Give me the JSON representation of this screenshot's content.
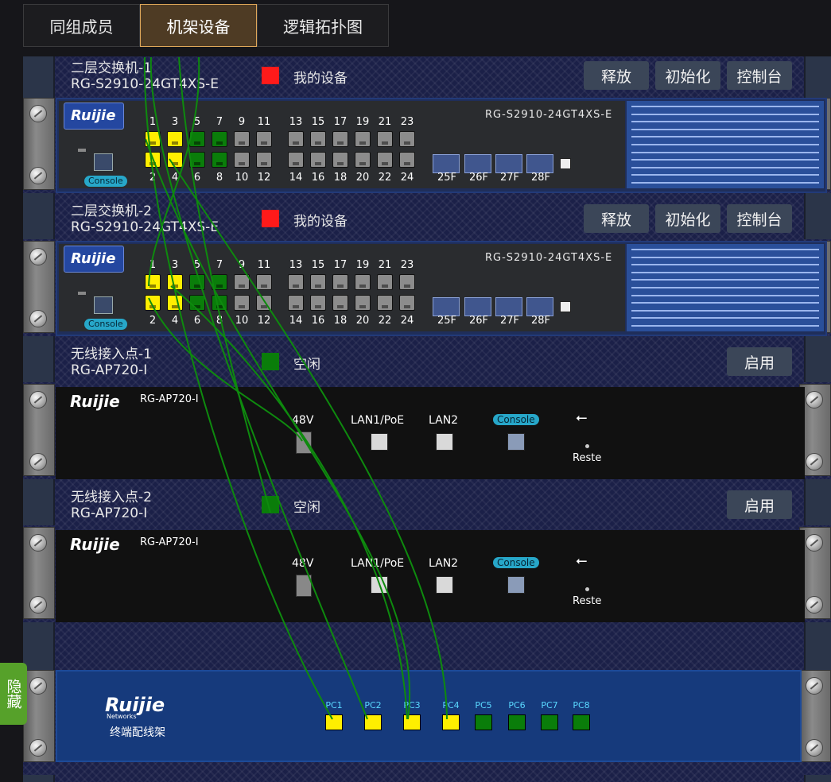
{
  "tabs": [
    {
      "label": "同组成员",
      "active": false
    },
    {
      "label": "机架设备",
      "active": true
    },
    {
      "label": "逻辑拓扑图",
      "active": false
    }
  ],
  "devices": [
    {
      "name": "二层交换机-1",
      "model": "RG-S2910-24GT4XS-E",
      "status_color": "#ff1a1a",
      "status": "我的设备",
      "buttons": [
        "释放",
        "初始化",
        "控制台"
      ],
      "brand": "Ruijie",
      "panel_model": "RG-S2910-24GT4XS-E",
      "top_port_labels": [
        "1",
        "3",
        "5",
        "7",
        "9",
        "11",
        "13",
        "15",
        "17",
        "19",
        "21",
        "23"
      ],
      "bottom_port_labels": [
        "2",
        "4",
        "6",
        "8",
        "10",
        "12",
        "14",
        "16",
        "18",
        "20",
        "22",
        "24"
      ],
      "sfp_labels": [
        "25F",
        "26F",
        "27F",
        "28F"
      ],
      "console_label": "Console",
      "port_colors_top": [
        "#ffee00",
        "#ffee00",
        "#0a7d0a",
        "#0a7d0a",
        "#8c8c8c",
        "#8c8c8c",
        "#8c8c8c",
        "#8c8c8c",
        "#8c8c8c",
        "#8c8c8c",
        "#8c8c8c",
        "#8c8c8c"
      ],
      "port_colors_bottom": [
        "#ffee00",
        "#ffee00",
        "#0a7d0a",
        "#0a7d0a",
        "#8c8c8c",
        "#8c8c8c",
        "#8c8c8c",
        "#8c8c8c",
        "#8c8c8c",
        "#8c8c8c",
        "#8c8c8c",
        "#8c8c8c"
      ]
    },
    {
      "name": "二层交换机-2",
      "model": "RG-S2910-24GT4XS-E",
      "status_color": "#ff1a1a",
      "status": "我的设备",
      "buttons": [
        "释放",
        "初始化",
        "控制台"
      ],
      "brand": "Ruijie",
      "panel_model": "RG-S2910-24GT4XS-E",
      "top_port_labels": [
        "1",
        "3",
        "5",
        "7",
        "9",
        "11",
        "13",
        "15",
        "17",
        "19",
        "21",
        "23"
      ],
      "bottom_port_labels": [
        "2",
        "4",
        "6",
        "8",
        "10",
        "12",
        "14",
        "16",
        "18",
        "20",
        "22",
        "24"
      ],
      "sfp_labels": [
        "25F",
        "26F",
        "27F",
        "28F"
      ],
      "console_label": "Console",
      "port_colors_top": [
        "#ffee00",
        "#ffee00",
        "#0a7d0a",
        "#0a7d0a",
        "#8c8c8c",
        "#8c8c8c",
        "#8c8c8c",
        "#8c8c8c",
        "#8c8c8c",
        "#8c8c8c",
        "#8c8c8c",
        "#8c8c8c"
      ],
      "port_colors_bottom": [
        "#ffee00",
        "#ffee00",
        "#0a7d0a",
        "#0a7d0a",
        "#8c8c8c",
        "#8c8c8c",
        "#8c8c8c",
        "#8c8c8c",
        "#8c8c8c",
        "#8c8c8c",
        "#8c8c8c",
        "#8c8c8c"
      ]
    },
    {
      "name": "无线接入点-1",
      "model": "RG-AP720-I",
      "status_color": "#0a7d0a",
      "status": "空闲",
      "buttons": [
        "启用"
      ],
      "brand": "Ruijie",
      "panel_model": "RG-AP720-I",
      "ap_labels": {
        "power": "48V",
        "lan1": "LAN1/PoE",
        "lan2": "LAN2",
        "console": "Console",
        "reset": "Reste"
      }
    },
    {
      "name": "无线接入点-2",
      "model": "RG-AP720-I",
      "status_color": "#0a7d0a",
      "status": "空闲",
      "buttons": [
        "启用"
      ],
      "brand": "Ruijie",
      "panel_model": "RG-AP720-I",
      "ap_labels": {
        "power": "48V",
        "lan1": "LAN1/PoE",
        "lan2": "LAN2",
        "console": "Console",
        "reset": "Reste"
      }
    }
  ],
  "patch_panel": {
    "brand": "Ruijie",
    "brand_sub": "Networks",
    "name": "终端配线架",
    "ports": [
      {
        "label": "PC1",
        "color": "#ffee00"
      },
      {
        "label": "PC2",
        "color": "#ffee00"
      },
      {
        "label": "PC3",
        "color": "#ffee00"
      },
      {
        "label": "PC4",
        "color": "#ffee00"
      },
      {
        "label": "PC5",
        "color": "#0a7d0a"
      },
      {
        "label": "PC6",
        "color": "#0a7d0a"
      },
      {
        "label": "PC7",
        "color": "#0a7d0a"
      },
      {
        "label": "PC8",
        "color": "#0a7d0a"
      }
    ]
  },
  "hide_button": "隐藏",
  "colors": {
    "cable": "#0e8a0e",
    "active_tab_border": "#e0a85a",
    "rack_bg": "#1b2048"
  }
}
